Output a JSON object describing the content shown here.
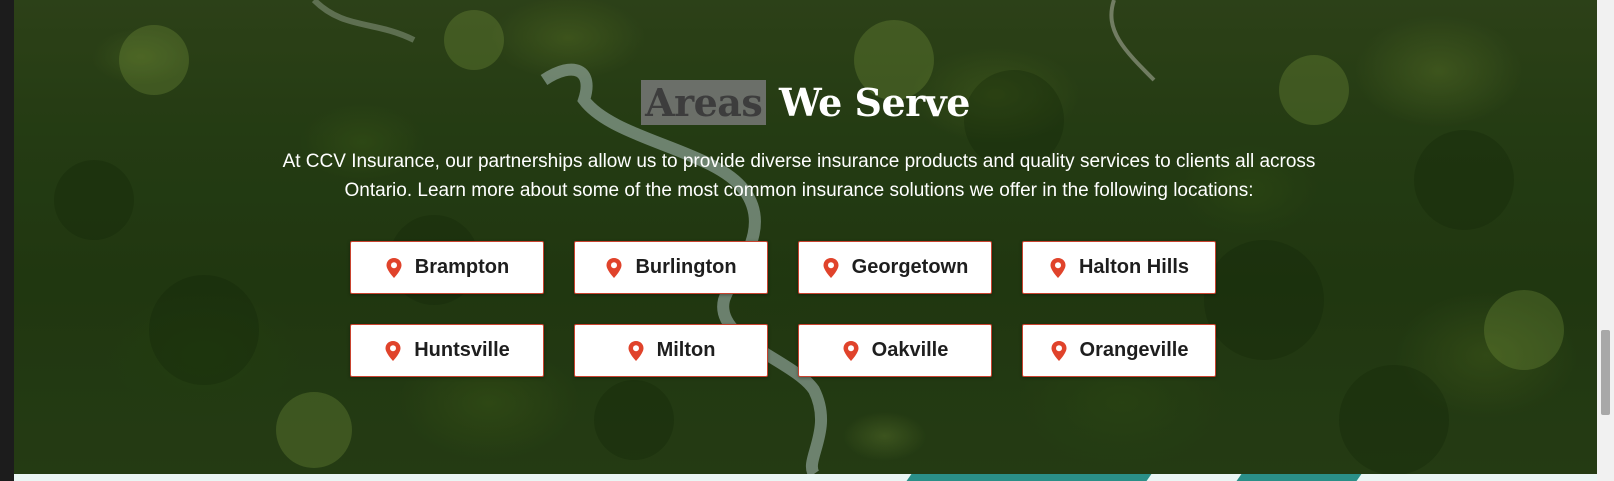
{
  "section": {
    "title_highlight": "Areas",
    "title_rest": " We Serve",
    "intro_line1": "At CCV Insurance, our partnerships allow us to provide diverse insurance products and quality services to clients all across",
    "intro_line2": "Ontario. Learn more about some of the most common insurance solutions we offer in the following locations:"
  },
  "locations": [
    {
      "label": "Brampton",
      "icon": "map-pin-icon"
    },
    {
      "label": "Burlington",
      "icon": "map-pin-icon"
    },
    {
      "label": "Georgetown",
      "icon": "map-pin-icon"
    },
    {
      "label": "Halton Hills",
      "icon": "map-pin-icon"
    },
    {
      "label": "Huntsville",
      "icon": "map-pin-icon"
    },
    {
      "label": "Milton",
      "icon": "map-pin-icon"
    },
    {
      "label": "Oakville",
      "icon": "map-pin-icon"
    },
    {
      "label": "Orangeville",
      "icon": "map-pin-icon"
    }
  ],
  "colors": {
    "accent": "#e0432b",
    "button_border": "#c9432f",
    "band_teal": "#2a8f88",
    "band_light": "#eaf6f4"
  }
}
